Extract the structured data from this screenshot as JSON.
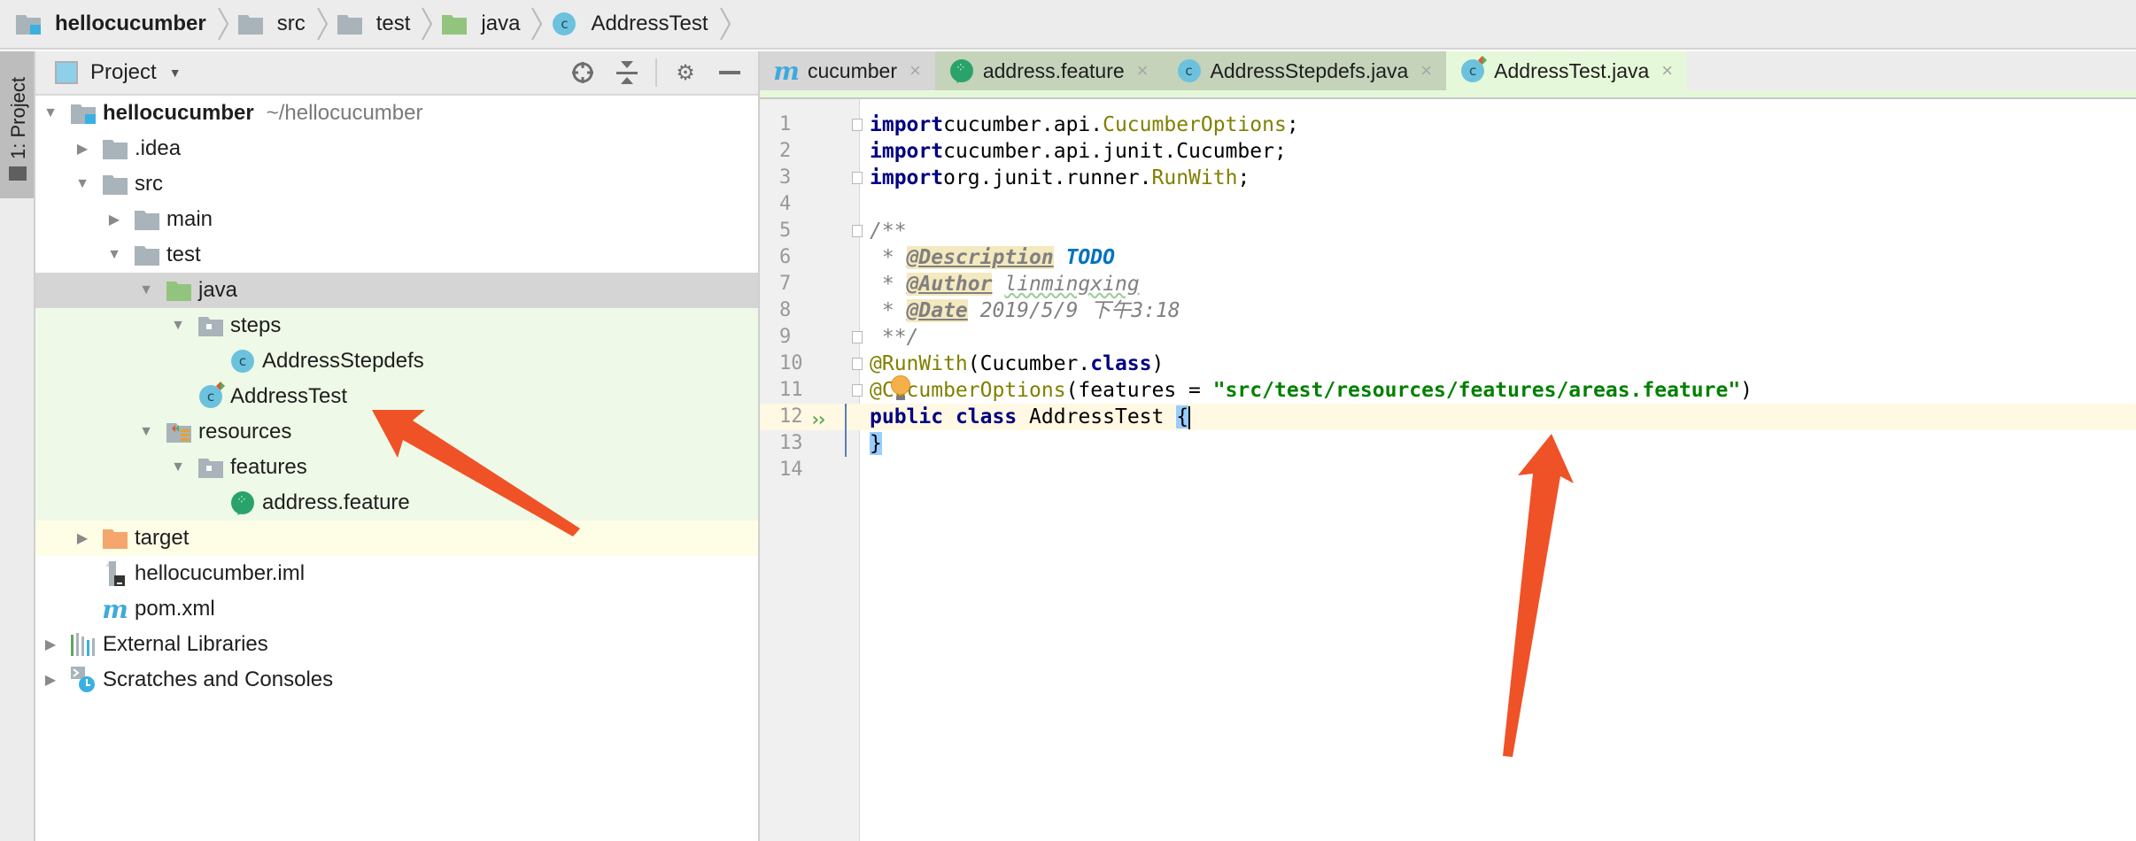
{
  "breadcrumb": [
    {
      "label": "hellocucumber",
      "icon": "module-folder-icon",
      "bold": true
    },
    {
      "label": "src",
      "icon": "folder-icon"
    },
    {
      "label": "test",
      "icon": "folder-icon"
    },
    {
      "label": "java",
      "icon": "test-source-folder-icon"
    },
    {
      "label": "AddressTest",
      "icon": "java-class-icon"
    }
  ],
  "tool_stripe": {
    "project_label": "1: Project"
  },
  "project_panel": {
    "title": "Project",
    "dropdown_icon": "chevron-down-icon",
    "header_icons": [
      "locate-icon",
      "collapse-all-icon",
      "gear-icon",
      "minimize-icon"
    ],
    "tree": [
      {
        "label": "hellocucumber",
        "suffix": "~/hellocucumber",
        "depth": 0,
        "expanded": true,
        "icon": "module-folder-icon",
        "bold": true
      },
      {
        "label": ".idea",
        "depth": 1,
        "expanded": false,
        "icon": "folder-icon"
      },
      {
        "label": "src",
        "depth": 1,
        "expanded": true,
        "icon": "folder-icon"
      },
      {
        "label": "main",
        "depth": 2,
        "expanded": false,
        "icon": "folder-icon"
      },
      {
        "label": "test",
        "depth": 2,
        "expanded": true,
        "icon": "folder-icon"
      },
      {
        "label": "java",
        "depth": 3,
        "expanded": true,
        "icon": "test-source-folder-icon",
        "selected": true
      },
      {
        "label": "steps",
        "depth": 4,
        "expanded": true,
        "icon": "package-icon"
      },
      {
        "label": "AddressStepdefs",
        "depth": 5,
        "icon": "java-class-icon"
      },
      {
        "label": "AddressTest",
        "depth": 4,
        "icon": "java-test-class-icon"
      },
      {
        "label": "resources",
        "depth": 3,
        "expanded": true,
        "icon": "test-resources-folder-icon"
      },
      {
        "label": "features",
        "depth": 4,
        "expanded": true,
        "icon": "package-icon"
      },
      {
        "label": "address.feature",
        "depth": 5,
        "icon": "cucumber-icon"
      },
      {
        "label": "target",
        "depth": 1,
        "expanded": false,
        "icon": "excluded-folder-icon"
      },
      {
        "label": "hellocucumber.iml",
        "depth": 1,
        "icon": "iml-file-icon"
      },
      {
        "label": "pom.xml",
        "depth": 1,
        "icon": "maven-icon"
      },
      {
        "label": "External Libraries",
        "depth": 0,
        "expanded": false,
        "icon": "libraries-icon"
      },
      {
        "label": "Scratches and Consoles",
        "depth": 0,
        "expanded": false,
        "icon": "scratches-icon"
      }
    ]
  },
  "editor": {
    "tabs": [
      {
        "label": "cucumber",
        "icon": "maven-icon",
        "state": "plain"
      },
      {
        "label": "address.feature",
        "icon": "cucumber-icon",
        "state": "test"
      },
      {
        "label": "AddressStepdefs.java",
        "icon": "java-class-icon",
        "state": "test"
      },
      {
        "label": "AddressTest.java",
        "icon": "java-test-class-icon",
        "state": "active"
      }
    ],
    "close_glyph": "×",
    "lines": [
      {
        "n": "1",
        "tokens": [
          [
            "kw",
            "import"
          ],
          [
            "",
            "cucumber.api."
          ],
          [
            "cls-ref",
            "CucumberOptions"
          ],
          [
            "",
            ";"
          ]
        ],
        "fold": true
      },
      {
        "n": "2",
        "tokens": [
          [
            "kw",
            "import"
          ],
          [
            "",
            "cucumber.api.junit.Cucumber;"
          ]
        ]
      },
      {
        "n": "3",
        "tokens": [
          [
            "kw",
            "import"
          ],
          [
            "",
            "org.junit.runner."
          ],
          [
            "cls-ref",
            "RunWith"
          ],
          [
            "",
            ";"
          ]
        ],
        "fold": true
      },
      {
        "n": "4",
        "tokens": []
      },
      {
        "n": "5",
        "tokens": [
          [
            "cmt",
            "/**"
          ]
        ],
        "fold": true
      },
      {
        "n": "6",
        "tokens": [
          [
            "cmt",
            " * "
          ],
          [
            "tag",
            "@Description"
          ],
          [
            "cmt",
            " "
          ],
          [
            "todo",
            "TODO"
          ]
        ]
      },
      {
        "n": "7",
        "tokens": [
          [
            "cmt",
            " * "
          ],
          [
            "tag",
            "@Author"
          ],
          [
            "cmt",
            " "
          ],
          [
            "cmt wavy",
            "linmingxing"
          ]
        ]
      },
      {
        "n": "8",
        "tokens": [
          [
            "cmt",
            " * "
          ],
          [
            "tag",
            "@Date"
          ],
          [
            "cmt",
            " 2019/5/9 下午3:18"
          ]
        ]
      },
      {
        "n": "9",
        "tokens": [
          [
            "cmt",
            " **/"
          ]
        ],
        "fold": true
      },
      {
        "n": "10",
        "tokens": [
          [
            "anno",
            "@RunWith"
          ],
          [
            "",
            "(Cucumber."
          ],
          [
            "kw",
            "class"
          ],
          [
            "",
            ")"
          ]
        ],
        "fold": true
      },
      {
        "n": "11",
        "tokens": [
          [
            "anno",
            "@CucumberOptions"
          ],
          [
            "",
            "(features = "
          ],
          [
            "str",
            "\"src/test/resources/features/areas.feature\""
          ],
          [
            "",
            ")"
          ]
        ],
        "fold": true,
        "bulb": true
      },
      {
        "n": "12",
        "tokens": [
          [
            "kw",
            "public"
          ],
          [
            "",
            " "
          ],
          [
            "kw",
            "class"
          ],
          [
            "",
            " AddressTest "
          ],
          [
            "brace-hl",
            "{"
          ]
        ],
        "current": true,
        "run": true,
        "caret": true
      },
      {
        "n": "13",
        "tokens": [
          [
            "brace-hl",
            "}"
          ]
        ]
      },
      {
        "n": "14",
        "tokens": []
      }
    ]
  },
  "annotations": {
    "arrow_color": "#ef5226"
  }
}
